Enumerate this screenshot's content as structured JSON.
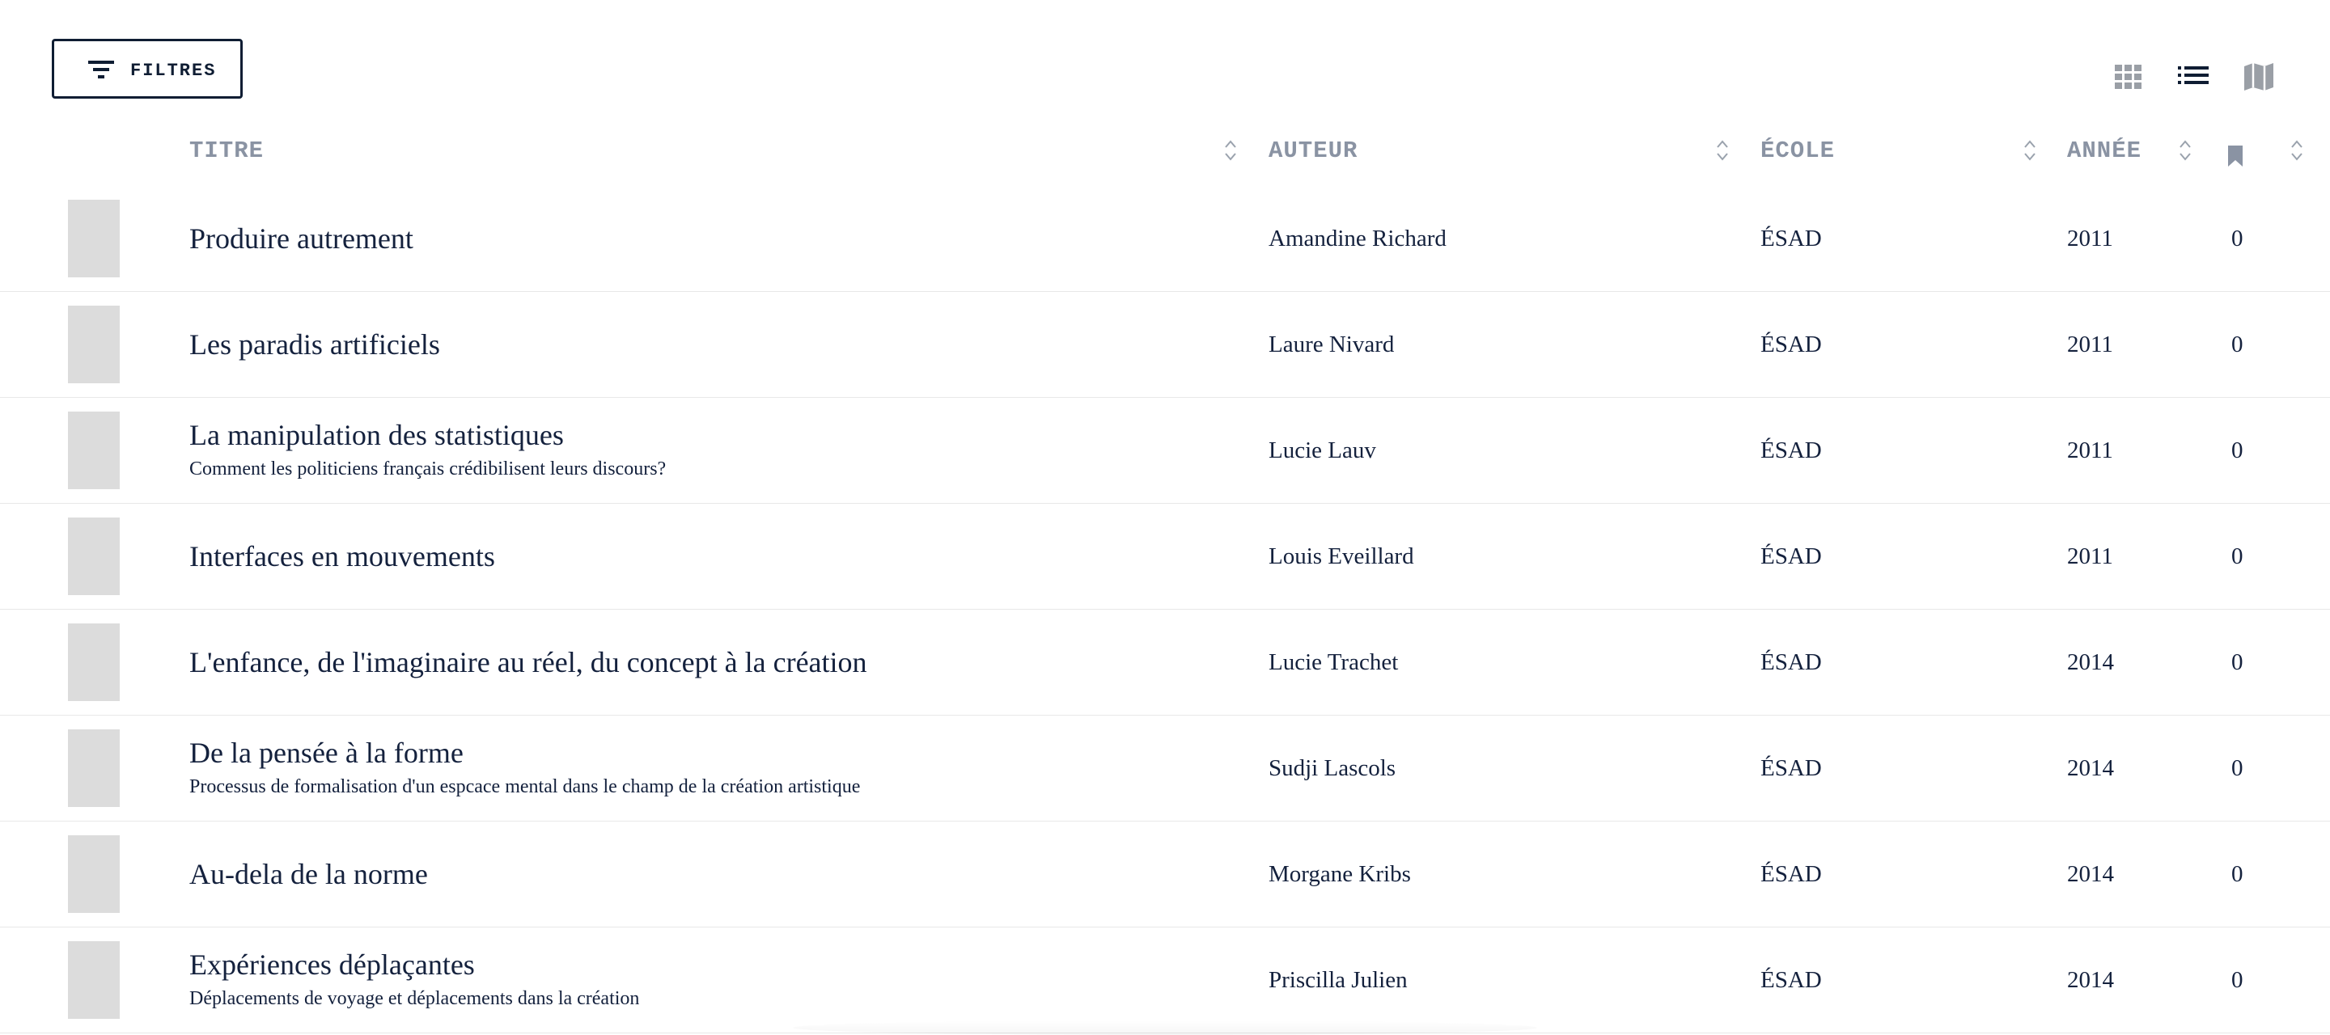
{
  "toolbar": {
    "filter_label": "FILTRES",
    "views": [
      {
        "name": "grid",
        "icon": "grid-icon",
        "active": false
      },
      {
        "name": "list",
        "icon": "list-icon",
        "active": true
      },
      {
        "name": "map",
        "icon": "map-icon",
        "active": false
      }
    ]
  },
  "table": {
    "headers": {
      "title": "TITRE",
      "author": "AUTEUR",
      "school": "ÉCOLE",
      "year": "ANNÉE",
      "bookmark_icon": "bookmark-icon",
      "sort_icon": "sort-icon"
    },
    "rows": [
      {
        "title": "Produire autrement",
        "subtitle": "",
        "author": "Amandine Richard",
        "school": "ÉSAD",
        "year": "2011",
        "count": "0"
      },
      {
        "title": "Les paradis artificiels",
        "subtitle": "",
        "author": "Laure Nivard",
        "school": "ÉSAD",
        "year": "2011",
        "count": "0"
      },
      {
        "title": "La manipulation des statistiques",
        "subtitle": "Comment les politiciens français crédibilisent leurs discours?",
        "author": "Lucie Lauv",
        "school": "ÉSAD",
        "year": "2011",
        "count": "0"
      },
      {
        "title": "Interfaces en mouvements",
        "subtitle": "",
        "author": "Louis Eveillard",
        "school": "ÉSAD",
        "year": "2011",
        "count": "0"
      },
      {
        "title": "L'enfance, de l'imaginaire au réel, du concept à la création",
        "subtitle": "",
        "author": "Lucie Trachet",
        "school": "ÉSAD",
        "year": "2014",
        "count": "0"
      },
      {
        "title": "De la pensée à la forme",
        "subtitle": "Processus de formalisation d'un espcace mental dans le champ de la création artistique",
        "author": "Sudji Lascols",
        "school": "ÉSAD",
        "year": "2014",
        "count": "0"
      },
      {
        "title": "Au-dela de la norme",
        "subtitle": "",
        "author": "Morgane Kribs",
        "school": "ÉSAD",
        "year": "2014",
        "count": "0"
      },
      {
        "title": "Expériences déplaçantes",
        "subtitle": "Déplacements de voyage et déplacements dans la création",
        "author": "Priscilla Julien",
        "school": "ÉSAD",
        "year": "2014",
        "count": "0"
      }
    ]
  },
  "colors": {
    "text": "#14213d",
    "header_text": "#8a93a3",
    "thumb_placeholder": "#dcdcdc",
    "divider": "#e8e8e8"
  }
}
